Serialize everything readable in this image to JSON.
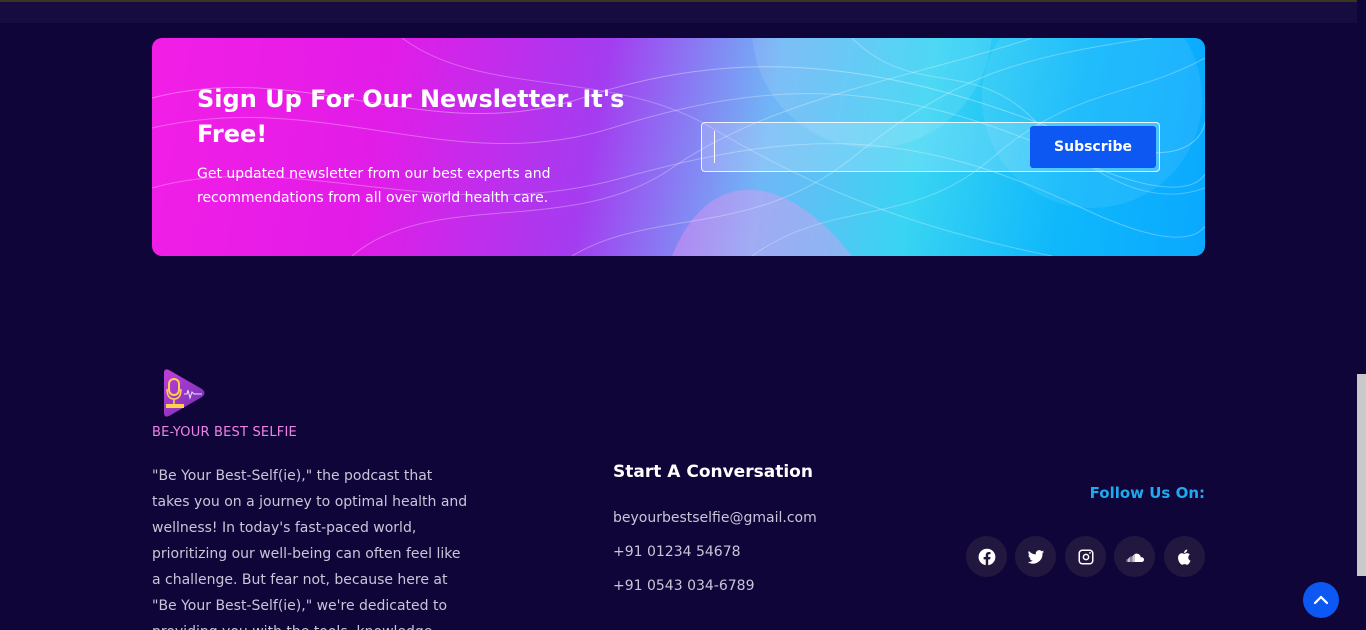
{
  "newsletter": {
    "title": "Sign Up For Our Newsletter. It's Free!",
    "description": "Get updated newsletter from our best experts and recommendations from all over world health care.",
    "email_value": "",
    "subscribe_label": "Subscribe"
  },
  "brand": {
    "name": "BE-YOUR BEST SELFIE",
    "about": "\"Be Your Best-Self(ie),\" the podcast that takes you on a journey to optimal health and wellness! In today's fast-paced world, prioritizing our well-being can often feel like a challenge. But fear not, because here at \"Be Your Best-Self(ie),\" we're dedicated to providing you with the tools, knowledge"
  },
  "contact": {
    "title": "Start A Conversation",
    "email": "beyourbestselfie@gmail.com",
    "phone1": "+91 01234 54678",
    "phone2": "+91 0543 034-6789"
  },
  "social": {
    "title": "Follow Us On:",
    "icons": [
      "facebook-icon",
      "twitter-icon",
      "instagram-icon",
      "soundcloud-icon",
      "apple-icon"
    ]
  },
  "colors": {
    "page_bg": "#0f0538",
    "accent_blue": "#0d58f3",
    "brand_pink": "#ee84e8",
    "follow_blue": "#1fa9ef"
  }
}
